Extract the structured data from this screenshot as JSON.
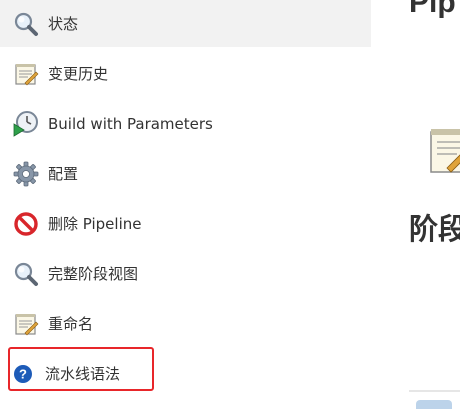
{
  "sidebar": {
    "items": [
      {
        "label": "状态",
        "icon": "magnifier-icon",
        "active": true
      },
      {
        "label": "变更历史",
        "icon": "notepad-icon"
      },
      {
        "label": "Build with Parameters",
        "icon": "clock-play-icon"
      },
      {
        "label": "配置",
        "icon": "gear-icon"
      },
      {
        "label": "删除 Pipeline",
        "icon": "no-entry-icon"
      },
      {
        "label": "完整阶段视图",
        "icon": "magnifier-icon"
      },
      {
        "label": "重命名",
        "icon": "notepad-icon"
      },
      {
        "label": "流水线语法",
        "icon": "help-icon"
      }
    ]
  },
  "main": {
    "title": "Pip",
    "stage_heading": "阶段"
  },
  "colors": {
    "highlight": "#e8262a",
    "active_bg": "#f2f2f2",
    "help_blue": "#1d5bb8"
  }
}
